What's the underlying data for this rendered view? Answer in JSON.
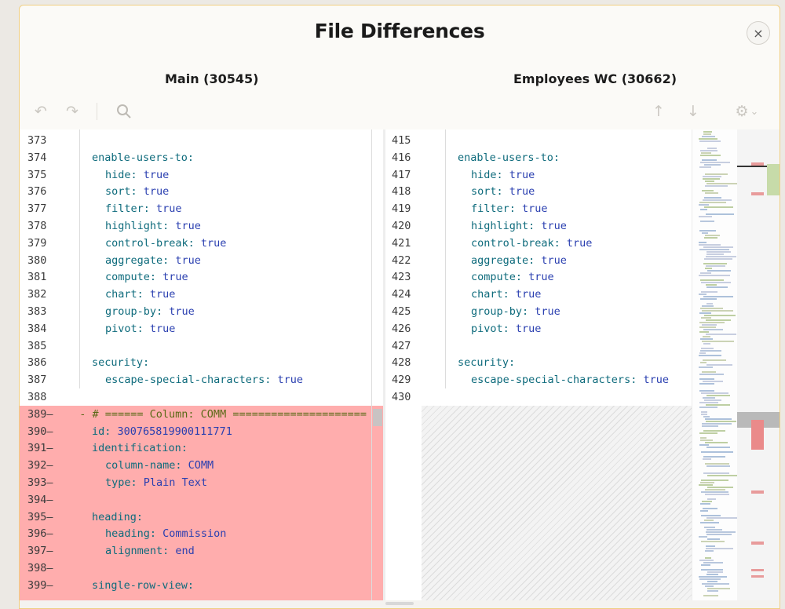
{
  "dialog": {
    "title": "File Differences",
    "close_label": "×"
  },
  "panes": {
    "left_title": "Main (30545)",
    "right_title": "Employees WC (30662)"
  },
  "toolbar": {
    "undo_icon": "↶",
    "redo_icon": "↷",
    "search_icon": "search-icon",
    "prev_diff_icon": "↑",
    "next_diff_icon": "↓",
    "settings_icon": "⚙",
    "settings_chevron": "⌄"
  },
  "left_lines": [
    {
      "num": "373",
      "indent": 0,
      "key": "",
      "value": ""
    },
    {
      "num": "374",
      "indent": 1,
      "key": "enable-users-to:",
      "value": ""
    },
    {
      "num": "375",
      "indent": 2,
      "key": "hide:",
      "value": " true"
    },
    {
      "num": "376",
      "indent": 2,
      "key": "sort:",
      "value": " true"
    },
    {
      "num": "377",
      "indent": 2,
      "key": "filter:",
      "value": " true"
    },
    {
      "num": "378",
      "indent": 2,
      "key": "highlight:",
      "value": " true"
    },
    {
      "num": "379",
      "indent": 2,
      "key": "control-break:",
      "value": " true"
    },
    {
      "num": "380",
      "indent": 2,
      "key": "aggregate:",
      "value": " true"
    },
    {
      "num": "381",
      "indent": 2,
      "key": "compute:",
      "value": " true"
    },
    {
      "num": "382",
      "indent": 2,
      "key": "chart:",
      "value": " true"
    },
    {
      "num": "383",
      "indent": 2,
      "key": "group-by:",
      "value": " true"
    },
    {
      "num": "384",
      "indent": 2,
      "key": "pivot:",
      "value": " true"
    },
    {
      "num": "385",
      "indent": 0,
      "key": "",
      "value": ""
    },
    {
      "num": "386",
      "indent": 1,
      "key": "security:",
      "value": ""
    },
    {
      "num": "387",
      "indent": 2,
      "key": "escape-special-characters:",
      "value": " true"
    },
    {
      "num": "388",
      "indent": 0,
      "key": "",
      "value": ""
    },
    {
      "num": "389—",
      "indent": 0,
      "key": "",
      "value": "",
      "comment": "  - # ====== Column: COMM ====================="
    },
    {
      "num": "390—",
      "indent": 1,
      "key": "id:",
      "value": " 300765819900111771"
    },
    {
      "num": "391—",
      "indent": 1,
      "key": "identification:",
      "value": ""
    },
    {
      "num": "392—",
      "indent": 2,
      "key": "column-name:",
      "value": " COMM"
    },
    {
      "num": "393—",
      "indent": 2,
      "key": "type:",
      "value": " Plain Text"
    },
    {
      "num": "394—",
      "indent": 0,
      "key": "",
      "value": ""
    },
    {
      "num": "395—",
      "indent": 1,
      "key": "heading:",
      "value": ""
    },
    {
      "num": "396—",
      "indent": 2,
      "key": "heading:",
      "value": " Commission"
    },
    {
      "num": "397—",
      "indent": 2,
      "key": "alignment:",
      "value": " end"
    },
    {
      "num": "398—",
      "indent": 0,
      "key": "",
      "value": ""
    },
    {
      "num": "399—",
      "indent": 1,
      "key": "single-row-view:",
      "value": ""
    }
  ],
  "right_lines": [
    {
      "num": "415",
      "indent": 0,
      "key": "",
      "value": ""
    },
    {
      "num": "416",
      "indent": 1,
      "key": "enable-users-to:",
      "value": ""
    },
    {
      "num": "417",
      "indent": 2,
      "key": "hide:",
      "value": " true"
    },
    {
      "num": "418",
      "indent": 2,
      "key": "sort:",
      "value": " true"
    },
    {
      "num": "419",
      "indent": 2,
      "key": "filter:",
      "value": " true"
    },
    {
      "num": "420",
      "indent": 2,
      "key": "highlight:",
      "value": " true"
    },
    {
      "num": "421",
      "indent": 2,
      "key": "control-break:",
      "value": " true"
    },
    {
      "num": "422",
      "indent": 2,
      "key": "aggregate:",
      "value": " true"
    },
    {
      "num": "423",
      "indent": 2,
      "key": "compute:",
      "value": " true"
    },
    {
      "num": "424",
      "indent": 2,
      "key": "chart:",
      "value": " true"
    },
    {
      "num": "425",
      "indent": 2,
      "key": "group-by:",
      "value": " true"
    },
    {
      "num": "426",
      "indent": 2,
      "key": "pivot:",
      "value": " true"
    },
    {
      "num": "427",
      "indent": 0,
      "key": "",
      "value": ""
    },
    {
      "num": "428",
      "indent": 1,
      "key": "security:",
      "value": ""
    },
    {
      "num": "429",
      "indent": 2,
      "key": "escape-special-characters:",
      "value": " true"
    },
    {
      "num": "430",
      "indent": 0,
      "key": "",
      "value": ""
    }
  ],
  "colors": {
    "removed": "#ffadad",
    "added": "#c7dba9",
    "key": "#0e6b7c",
    "value": "#2a3fb0",
    "comment": "#5b6a17"
  }
}
